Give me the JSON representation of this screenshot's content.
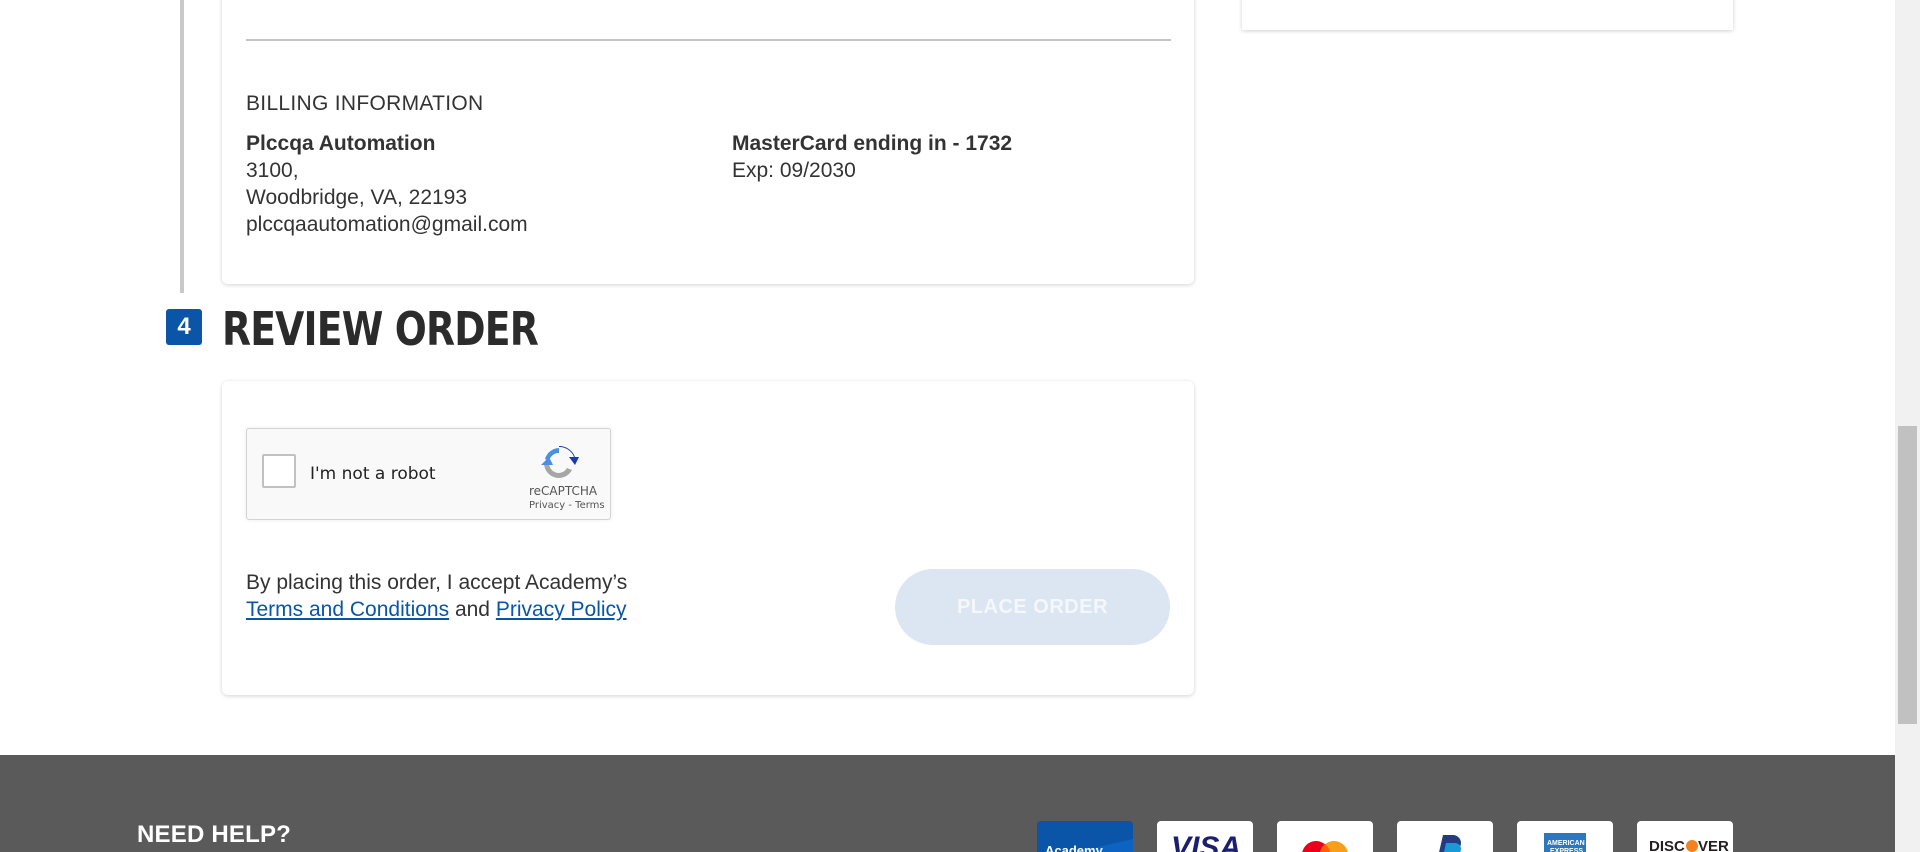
{
  "billing": {
    "heading": "BILLING INFORMATION",
    "name": "Plccqa Automation",
    "address_line1": "3100,",
    "address_line2": "Woodbridge, VA, 22193",
    "email": "plccqaautomation@gmail.com",
    "card_label": "MasterCard ending in - 1732",
    "card_exp": "Exp: 09/2030"
  },
  "review": {
    "step_number": "4",
    "title": "REVIEW ORDER",
    "captcha_label": "I'm not a robot",
    "captcha_brand": "reCAPTCHA",
    "captcha_links": "Privacy - Terms",
    "accept_prefix": "By placing this order, I accept Academy’s",
    "terms_link": "Terms and Conditions",
    "and_text": "and",
    "privacy_link": "Privacy Policy",
    "place_order_label": "PLACE ORDER"
  },
  "footer": {
    "need_help": "NEED HELP?",
    "payment_methods": [
      {
        "name": "Academy",
        "icon": "academy-card-icon"
      },
      {
        "name": "VISA",
        "icon": "visa-icon"
      },
      {
        "name": "MasterCard",
        "icon": "mastercard-icon"
      },
      {
        "name": "PayPal",
        "icon": "paypal-icon"
      },
      {
        "name": "American Express",
        "icon": "amex-icon"
      },
      {
        "name": "DISCOVER",
        "icon": "discover-icon"
      }
    ]
  },
  "colors": {
    "accent": "#0a55a8",
    "button_disabled": "#dbe6f2",
    "footer_bg": "#5a5a5a"
  }
}
